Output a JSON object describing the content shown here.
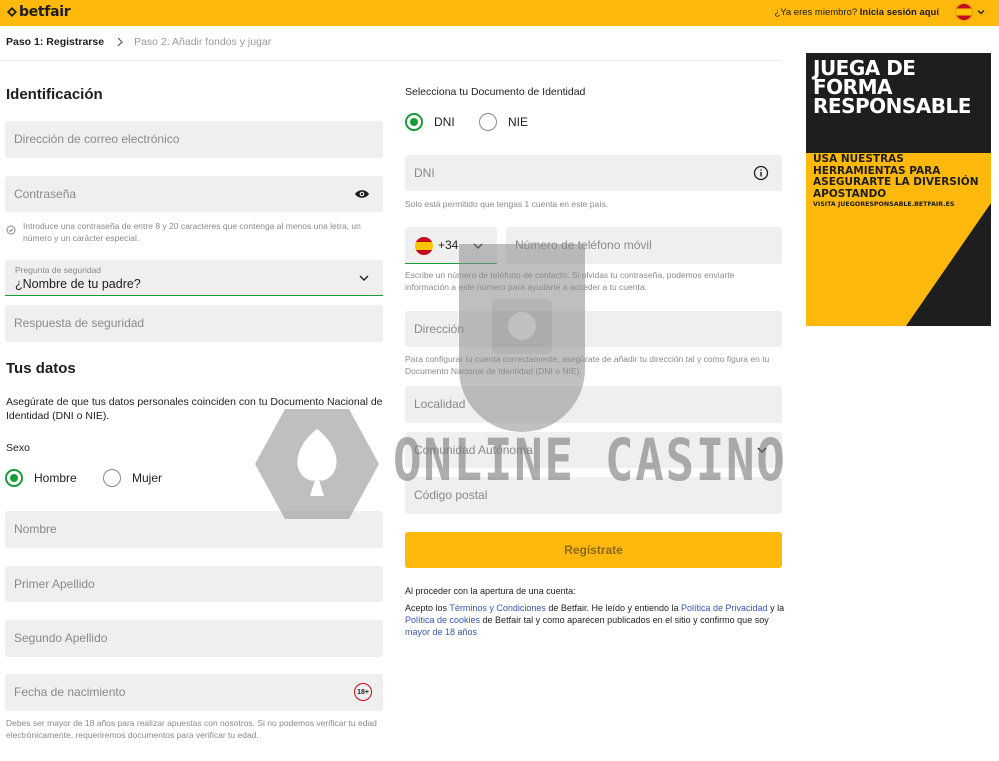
{
  "header": {
    "logo_text": "betfair",
    "member_question": "¿Ya eres miembro?",
    "login_link": "Inicia sesión aquí"
  },
  "steps": {
    "step1": "Paso 1: Registrarse",
    "step2": "Paso 2: Añadir fondos y jugar"
  },
  "identification": {
    "heading": "Identificación",
    "email_placeholder": "Dirección de correo electrónico",
    "password_placeholder": "Contraseña",
    "password_hint": "Introduce una contraseña de entre 8 y 20 caracteres que contenga al menos una letra, un número y un carácter especial.",
    "security_question_label": "Pregunta de seguridad",
    "security_question_value": "¿Nombre de tu padre?",
    "security_answer_placeholder": "Respuesta de seguridad"
  },
  "personal": {
    "heading": "Tus datos",
    "note": "Asegúrate de que tus datos personales coinciden con tu Documento Nacional de Identidad (DNI o NIE).",
    "sex_label": "Sexo",
    "male": "Hombre",
    "female": "Mujer",
    "name_placeholder": "Nombre",
    "surname1_placeholder": "Primer Apellido",
    "surname2_placeholder": "Segundo Apellido",
    "dob_placeholder": "Fecha de nacimiento",
    "age_badge": "18+",
    "dob_hint": "Debes ser mayor de 18 años para realizar apuestas con nosotros. Si no podemos verificar tu edad electrónicamente, requeriremos documentos para verificar tu edad."
  },
  "document": {
    "label": "Selecciona tu Documento de Identidad",
    "dni": "DNI",
    "nie": "NIE",
    "dni_placeholder": "DNI",
    "dni_hint": "Solo está permitido que tengas 1 cuenta en este país."
  },
  "phone": {
    "prefix": "+34",
    "placeholder": "Número de teléfono móvil",
    "hint": "Escribe un número de teléfono de contacto. Si olvidas tu contraseña, podemos enviarte información a este número para ayudarte a acceder a tu cuenta."
  },
  "address": {
    "placeholder": "Dirección",
    "hint": "Para configurar tu cuenta correctamente, asegúrate de añadir tu dirección tal y como figura en tu Documento Nacional de Identidad (DNI o NIE).",
    "city_placeholder": "Localidad",
    "region_placeholder": "Comunidad Autónoma",
    "postcode_placeholder": "Código postal"
  },
  "register_button": "Regístrate",
  "legal": {
    "intro": "Al proceder con la apertura de una cuenta:",
    "t1": "Acepto los ",
    "terms": "Términos y Condiciones",
    "t2": " de Betfair. He leído y entiendo la ",
    "privacy": "Política de Privacidad",
    "t3": " y la ",
    "cookies": "Política de cookies",
    "t4": " de Betfair tal y como aparecen publicados en el sitio y confirmo que soy ",
    "age": "mayor de 18 años"
  },
  "ad": {
    "title": "JUEGA DE FORMA RESPONSABLE",
    "subtitle": "USA NUESTRAS HERRAMIENTAS PARA ASEGURARTE LA DIVERSIÓN APOSTANDO",
    "url": "VISITA JUEGORESPONSABLE.BETFAIR.ES"
  },
  "watermark": {
    "text": "ONLINE CASINO"
  },
  "colors": {
    "brand_yellow": "#ffb80c",
    "field_bg": "#efefef",
    "accent_green": "#179c3a",
    "link_blue": "#3657a8"
  }
}
